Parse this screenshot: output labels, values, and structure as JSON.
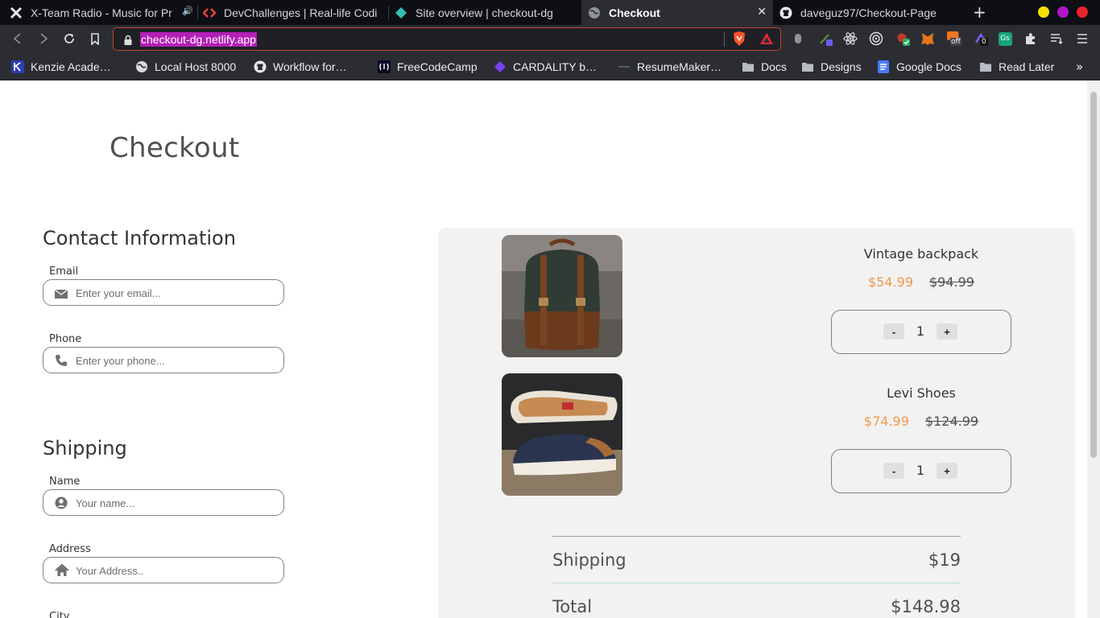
{
  "browser": {
    "tabs": [
      {
        "title": "X-Team Radio - Music for Pr",
        "icon": "x-team-icon",
        "active": false
      },
      {
        "title": "DevChallenges | Real-life Codi",
        "icon": "devchallenges-icon",
        "active": false
      },
      {
        "title": "Site overview | checkout-dg",
        "icon": "netlify-icon",
        "active": false
      },
      {
        "title": "Checkout",
        "icon": "globe-icon",
        "active": true
      },
      {
        "title": "daveguz97/Checkout-Page",
        "icon": "github-icon",
        "active": false
      }
    ],
    "url": "checkout-dg.netlify.app",
    "bookmarks": [
      {
        "label": "Kenzie Acade…",
        "icon": "kenzie-icon"
      },
      {
        "label": "Local Host 8000",
        "icon": "globe-icon"
      },
      {
        "label": "Workflow for…",
        "icon": "github-icon"
      },
      {
        "label": "FreeCodeCamp",
        "icon": "freecodecamp-icon"
      },
      {
        "label": "CARDALITY b…",
        "icon": "cardality-icon"
      },
      {
        "label": "ResumeMaker…",
        "icon": "resumemaker-icon"
      },
      {
        "label": "Docs",
        "icon": "folder-icon"
      },
      {
        "label": "Designs",
        "icon": "folder-icon"
      },
      {
        "label": "Google Docs",
        "icon": "google-docs-icon"
      },
      {
        "label": "Read Later",
        "icon": "folder-icon"
      }
    ],
    "extension_badges": {
      "off": "off",
      "count": "0",
      "gs": "Gs"
    }
  },
  "page": {
    "title": "Checkout",
    "contact": {
      "heading": "Contact Information",
      "email": {
        "label": "Email",
        "placeholder": "Enter your email..."
      },
      "phone": {
        "label": "Phone",
        "placeholder": "Enter your phone..."
      }
    },
    "shipping": {
      "heading": "Shipping",
      "name": {
        "label": "Name",
        "placeholder": "Your name..."
      },
      "address": {
        "label": "Address",
        "placeholder": "Your Address.."
      },
      "city": {
        "label": "City"
      }
    }
  },
  "cart": {
    "items": [
      {
        "name": "Vintage backpack",
        "price": "$54.99",
        "original_price": "$94.99",
        "quantity": "1"
      },
      {
        "name": "Levi Shoes",
        "price": "$74.99",
        "original_price": "$124.99",
        "quantity": "1"
      }
    ],
    "minus_label": "-",
    "plus_label": "+",
    "shipping_label": "Shipping",
    "shipping_value": "$19",
    "total_label": "Total",
    "total_value": "$148.98"
  },
  "colors": {
    "accent_price": "#f2994a",
    "url_highlight": "#b31fb8",
    "cart_bg": "#f2f2f2"
  }
}
